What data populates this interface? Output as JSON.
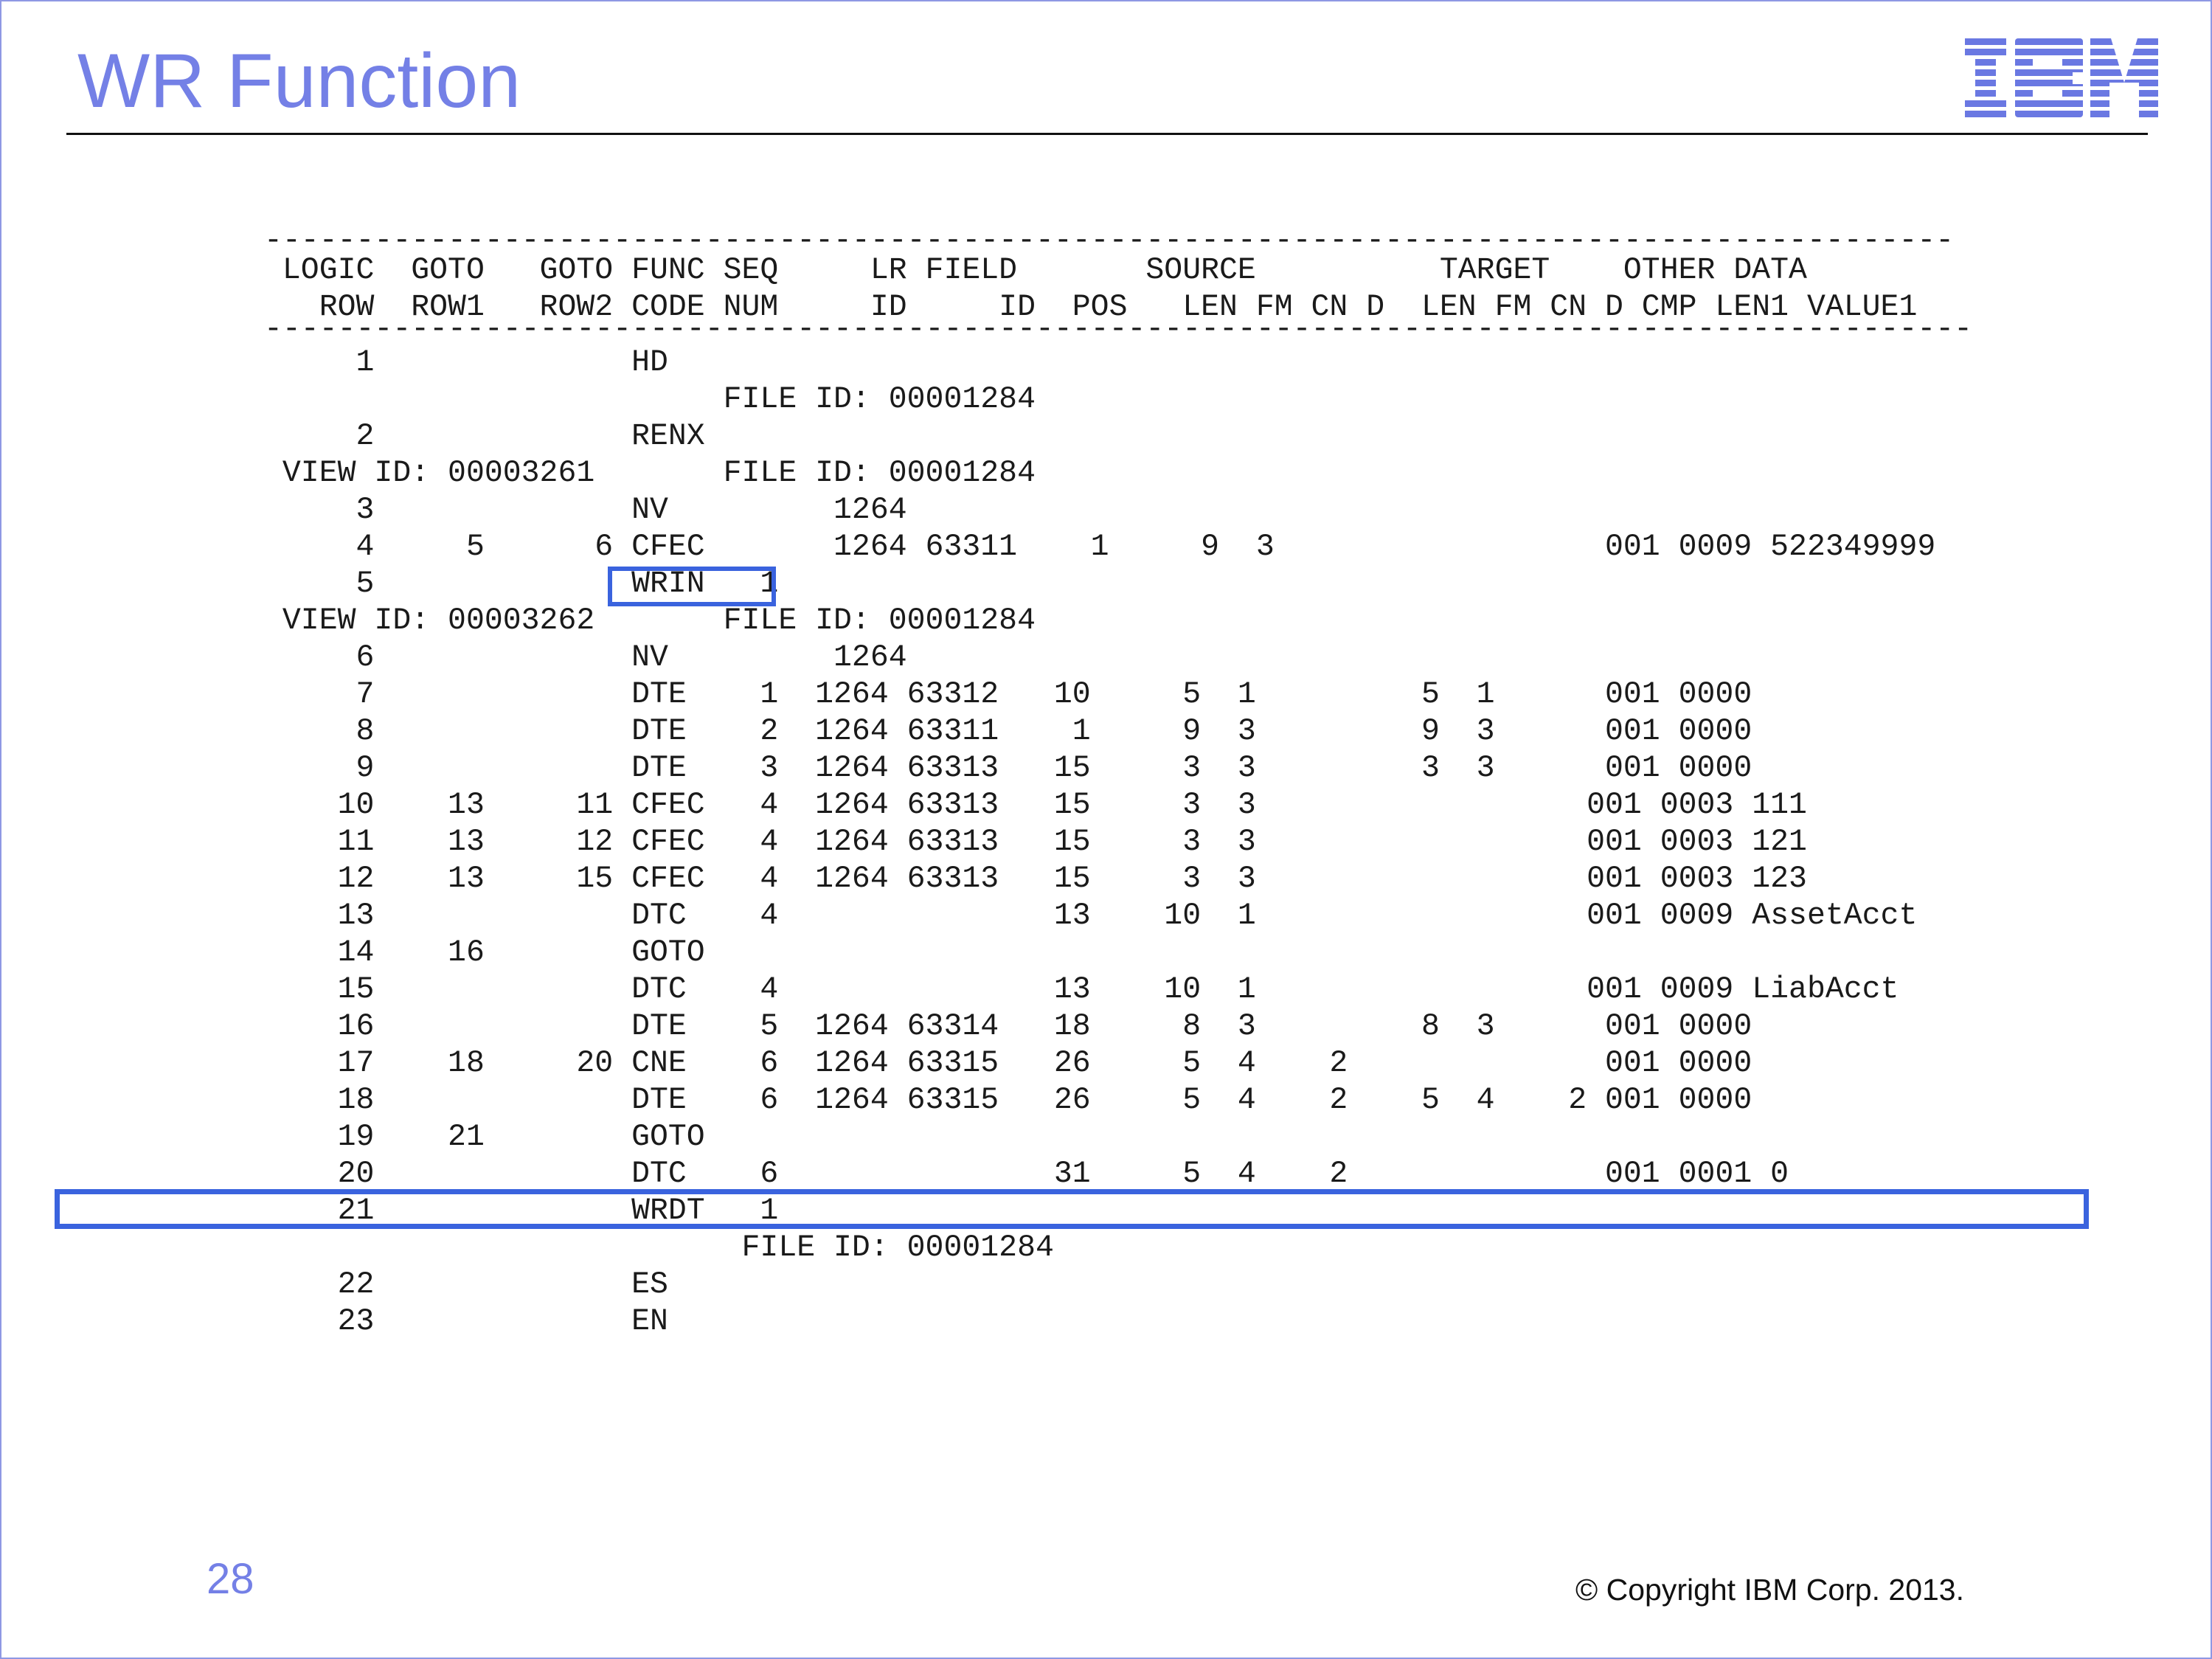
{
  "slide": {
    "title": "WR Function",
    "page_number": "28",
    "copyright": "© Copyright IBM Corp. 2013.",
    "logo": {
      "icon": "ibm-striped-logo",
      "text": "IBM",
      "color": "#6a78e2"
    }
  },
  "listing": {
    "lines": [
      "--------------------------------------------------------------------------------------------",
      " LOGIC  GOTO   GOTO FUNC SEQ     LR FIELD       SOURCE          TARGET    OTHER DATA",
      "   ROW  ROW1   ROW2 CODE NUM     ID     ID  POS   LEN FM CN D  LEN FM CN D CMP LEN1 VALUE1",
      "---------------------------------------------------------------------------------------------",
      "     1              HD",
      "                         FILE ID: 00001284",
      "     2              RENX",
      " VIEW ID: 00003261       FILE ID: 00001284",
      "     3              NV         1264",
      "     4     5      6 CFEC       1264 63311    1     9  3                  001 0009 522349999",
      "     5              WRIN   1",
      " VIEW ID: 00003262       FILE ID: 00001284",
      "     6              NV         1264",
      "     7              DTE    1  1264 63312   10     5  1         5  1      001 0000",
      "     8              DTE    2  1264 63311    1     9  3         9  3      001 0000",
      "     9              DTE    3  1264 63313   15     3  3         3  3      001 0000",
      "    10    13     11 CFEC   4  1264 63313   15     3  3                  001 0003 111",
      "    11    13     12 CFEC   4  1264 63313   15     3  3                  001 0003 121",
      "    12    13     15 CFEC   4  1264 63313   15     3  3                  001 0003 123",
      "    13              DTC    4               13    10  1                  001 0009 AssetAcct",
      "    14    16        GOTO",
      "    15              DTC    4               13    10  1                  001 0009 LiabAcct",
      "    16              DTE    5  1264 63314   18     8  3         8  3      001 0000",
      "    17    18     20 CNE    6  1264 63315   26     5  4    2              001 0000",
      "    18              DTE    6  1264 63315   26     5  4    2    5  4    2 001 0000",
      "    19    21        GOTO",
      "    20              DTC    6               31     5  4    2              001 0001 0",
      "    21              WRDT   1",
      "                          FILE ID: 00001284",
      "    22              ES",
      "    23              EN"
    ],
    "highlights": [
      "WRIN   1",
      "row 21 WRDT   1"
    ],
    "highlight_color": "#3a63de"
  }
}
